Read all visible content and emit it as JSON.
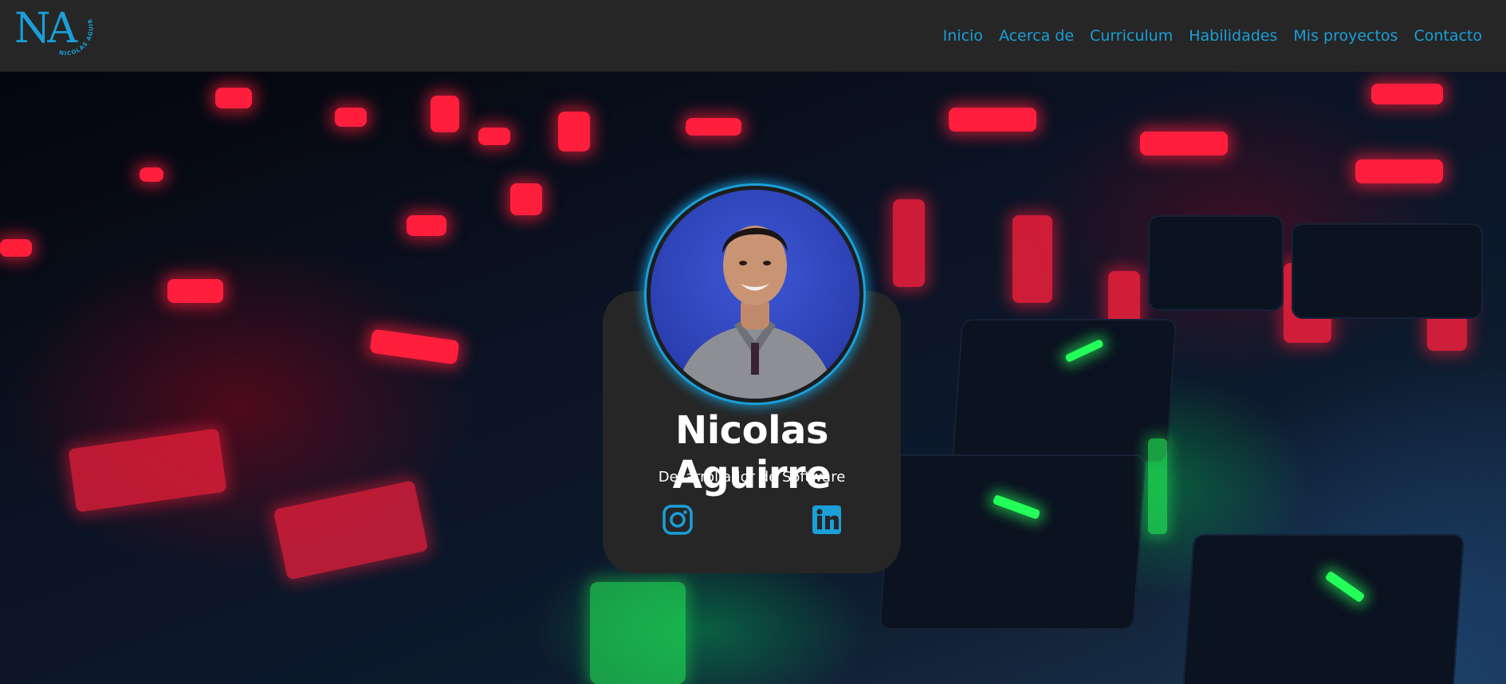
{
  "logo": {
    "letters": "NA",
    "ring_text": "NICOLAS AGUIRRE"
  },
  "nav": {
    "items": [
      "Inicio",
      "Acerca de",
      "Curriculum",
      "Habilidades",
      "Mis proyectos",
      "Contacto"
    ]
  },
  "profile": {
    "name": "Nicolas Aguirre",
    "role": "Desarrollador de Software",
    "social": [
      {
        "icon": "instagram-icon"
      },
      {
        "icon": "linkedin-icon"
      }
    ]
  },
  "colors": {
    "accent": "#1a9fd8",
    "navbar_bg": "#262626",
    "card_bg": "#262626",
    "text": "#ffffff"
  }
}
